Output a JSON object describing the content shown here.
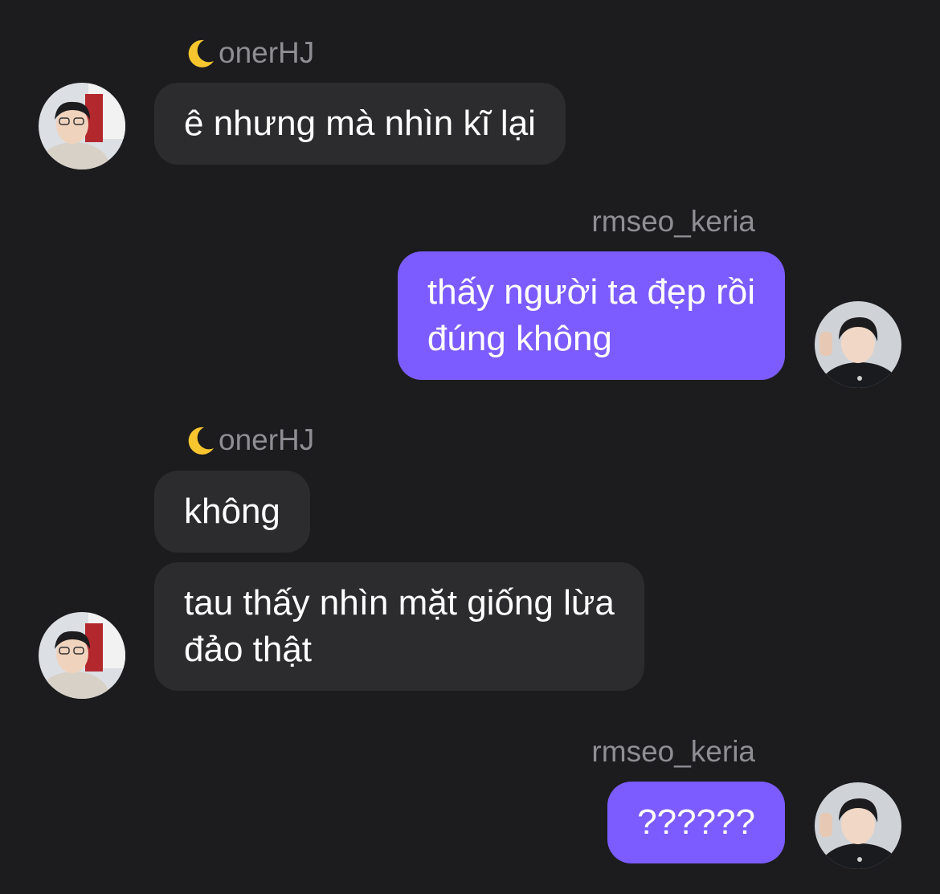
{
  "colors": {
    "background": "#1c1c1e",
    "incoming_bubble": "#2c2c2e",
    "outgoing_bubble": "#7c5cff",
    "name_text": "#8e8e93",
    "message_text": "#ffffff"
  },
  "messages": [
    {
      "sender": "onerHJ",
      "sender_icon": "crescent-moon-icon",
      "direction": "incoming",
      "text": "ê nhưng mà nhìn kĩ lại"
    },
    {
      "sender": "rmseo_keria",
      "direction": "outgoing",
      "text": "thấy người ta đẹp rồi\nđúng không"
    },
    {
      "sender": "onerHJ",
      "sender_icon": "crescent-moon-icon",
      "direction": "incoming",
      "text": "không"
    },
    {
      "direction": "incoming",
      "text": "tau thấy nhìn mặt giống lừa\nđảo thật"
    },
    {
      "sender": "rmseo_keria",
      "direction": "outgoing",
      "text": "??????"
    }
  ]
}
